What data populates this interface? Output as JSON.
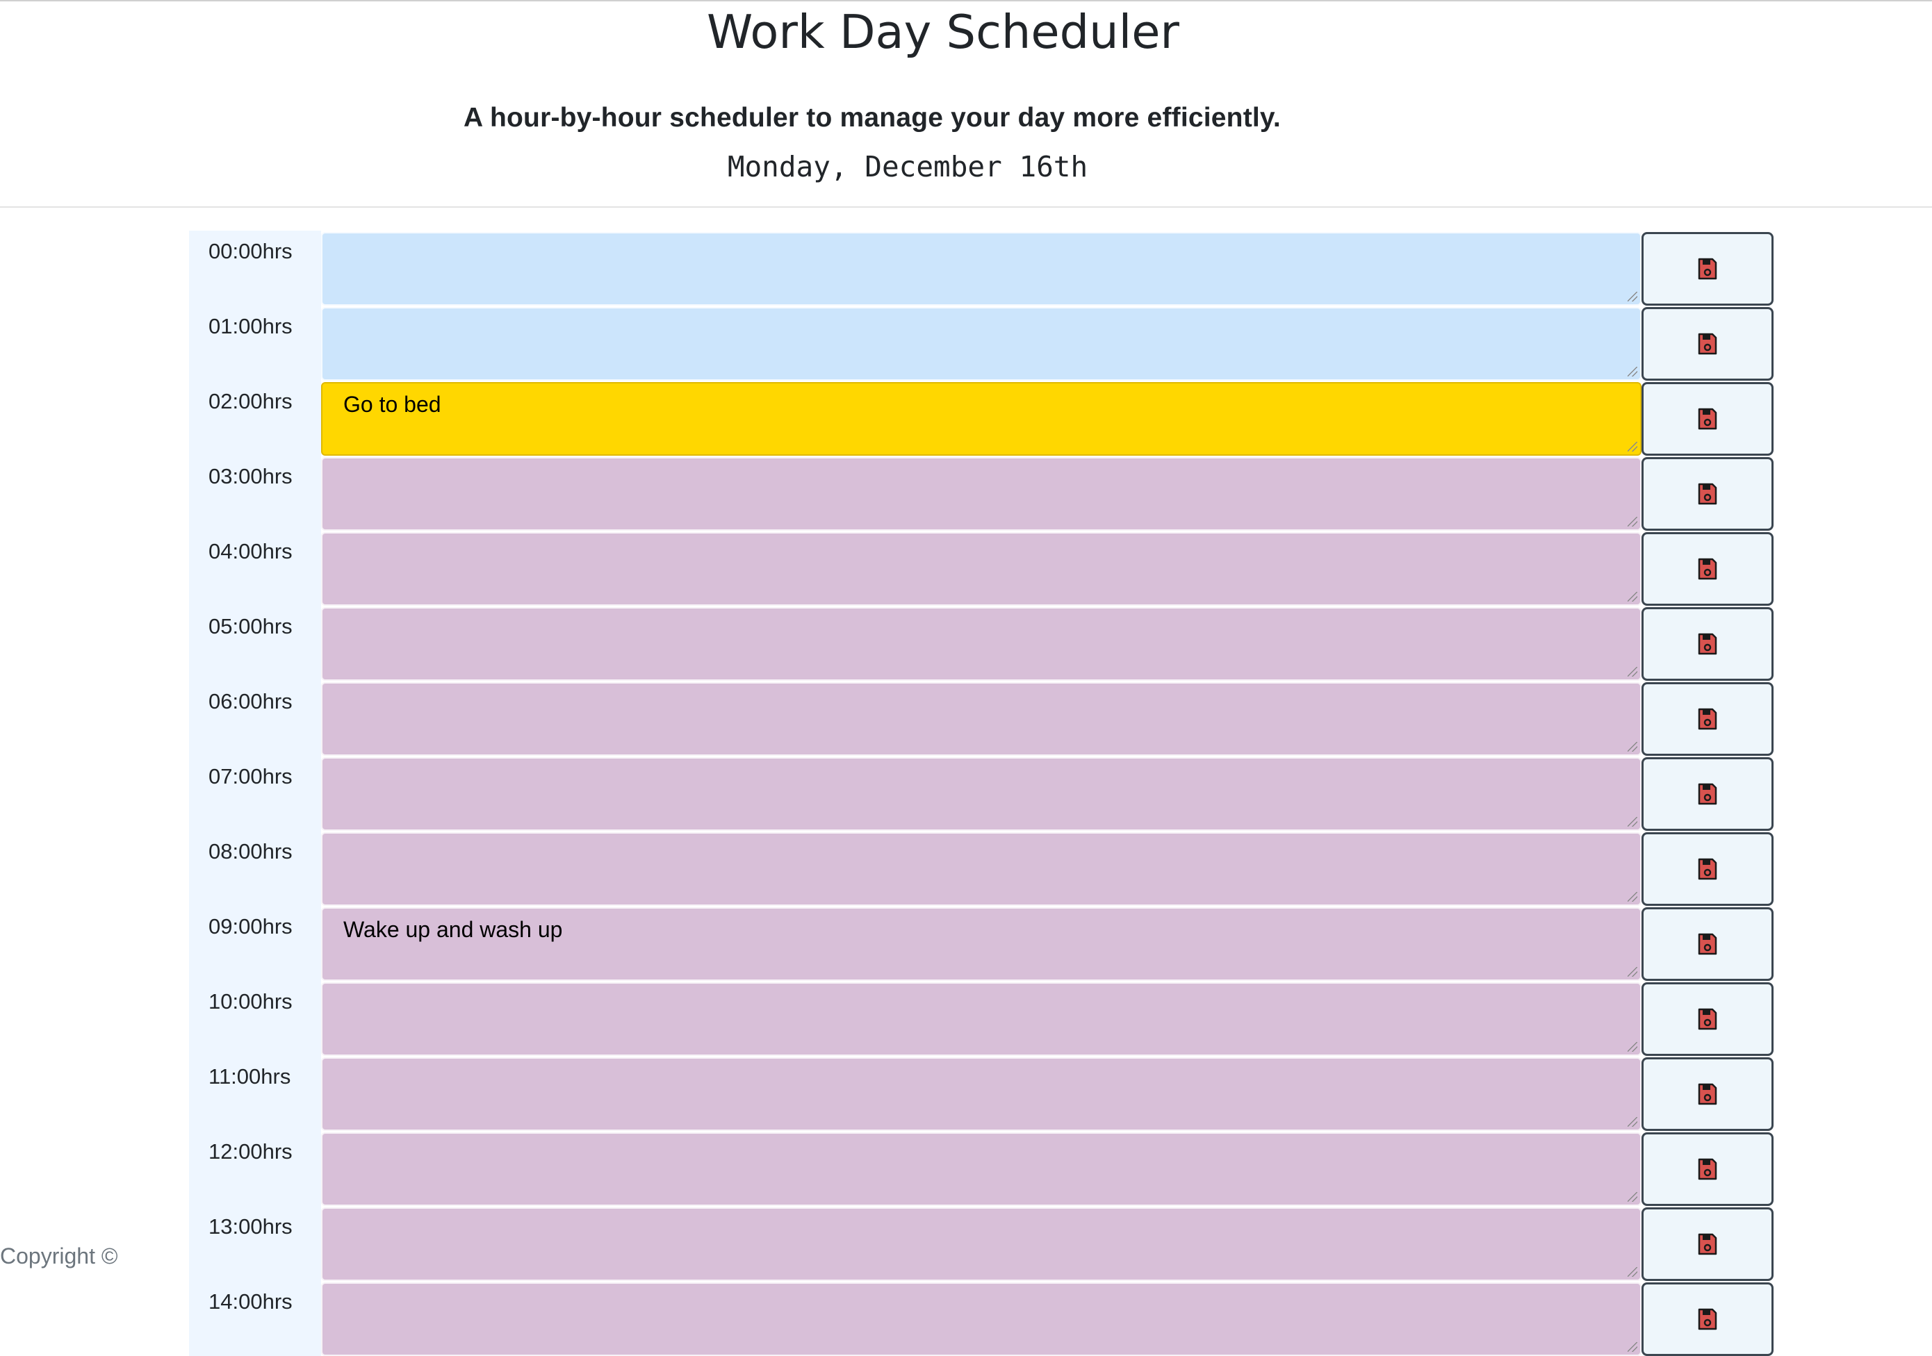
{
  "header": {
    "title": "Work Day Scheduler",
    "lead": "A hour-by-hour scheduler to manage your day more efficiently.",
    "current_day": "Monday, December 16th"
  },
  "colors": {
    "future": "#cce5fc",
    "present": "#ffd700",
    "past": "#d8bfd8",
    "hour_bg": "#eef6ff",
    "save_icon": "#d9534f"
  },
  "save_icon_name": "floppy-disk-icon",
  "blocks": [
    {
      "hour": "00:00hrs",
      "text": "",
      "state": "future"
    },
    {
      "hour": "01:00hrs",
      "text": "",
      "state": "future"
    },
    {
      "hour": "02:00hrs",
      "text": "Go to bed",
      "state": "present"
    },
    {
      "hour": "03:00hrs",
      "text": "",
      "state": "past"
    },
    {
      "hour": "04:00hrs",
      "text": "",
      "state": "past"
    },
    {
      "hour": "05:00hrs",
      "text": "",
      "state": "past"
    },
    {
      "hour": "06:00hrs",
      "text": "",
      "state": "past"
    },
    {
      "hour": "07:00hrs",
      "text": "",
      "state": "past"
    },
    {
      "hour": "08:00hrs",
      "text": "",
      "state": "past"
    },
    {
      "hour": "09:00hrs",
      "text": "Wake up and wash up",
      "state": "past"
    },
    {
      "hour": "10:00hrs",
      "text": "",
      "state": "past"
    },
    {
      "hour": "11:00hrs",
      "text": "",
      "state": "past"
    },
    {
      "hour": "12:00hrs",
      "text": "",
      "state": "past"
    },
    {
      "hour": "13:00hrs",
      "text": "",
      "state": "past"
    },
    {
      "hour": "14:00hrs",
      "text": "",
      "state": "past"
    }
  ],
  "footer": {
    "copyright": "Copyright ©"
  }
}
